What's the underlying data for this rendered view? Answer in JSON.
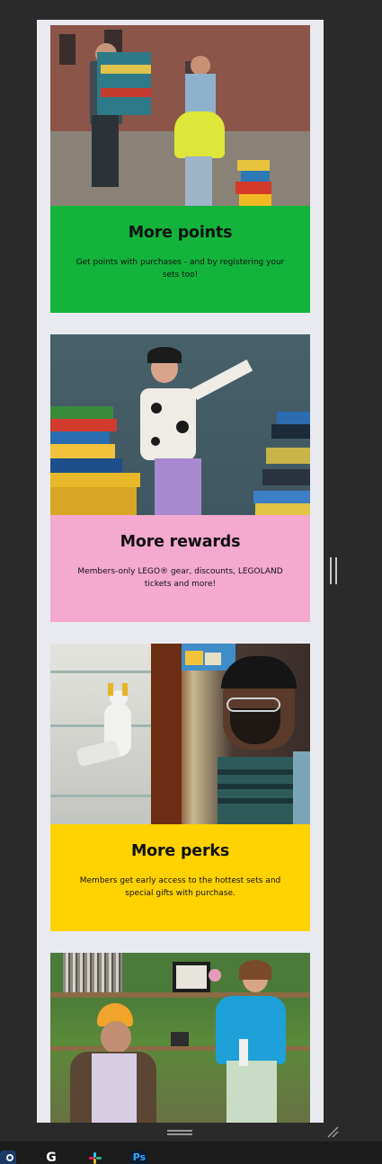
{
  "cards": [
    {
      "title": "More points",
      "text": "Get points with purchases - and by registering your sets too!",
      "color": "#13b43b"
    },
    {
      "title": "More rewards",
      "text": "Members-only LEGO® gear, discounts, LEGOLAND tickets and more!",
      "color": "#f4a9ce"
    },
    {
      "title": "More perks",
      "text": "Members get early access to the hottest sets and special gifts with purchase.",
      "color": "#ffd200"
    }
  ],
  "taskbar": {
    "steam": "steam-icon",
    "g_label": "G",
    "slack": "slack-icon",
    "ps_label": "Ps"
  }
}
